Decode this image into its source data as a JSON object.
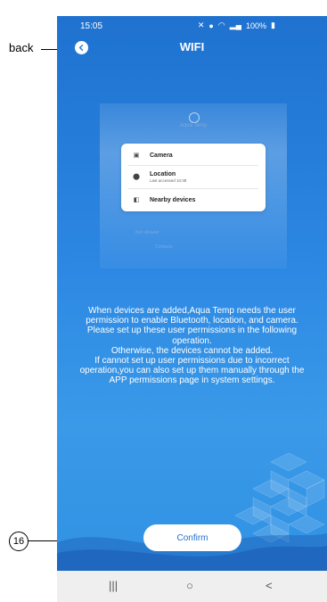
{
  "status_bar": {
    "time": "15:05",
    "battery": "100%"
  },
  "header": {
    "title": "WIFI"
  },
  "illustration": {
    "app_name": "Aqua Temp",
    "permissions": [
      {
        "label": "Camera",
        "sub": ""
      },
      {
        "label": "Location",
        "sub": "Last accessed 10:38"
      },
      {
        "label": "Nearby devices",
        "sub": ""
      }
    ],
    "not_allowed": "Not allowed",
    "faded_item": "Contacts"
  },
  "description": [
    "When devices are added,Aqua Temp needs the user permission to enable Bluetooth, location, and camera.",
    "Please set up these user permissions in the following operation.",
    "Otherwise, the devices cannot be added.",
    "If cannot set up user permissions due to incorrect operation,you can also set up them manually through the APP permissions page in system settings."
  ],
  "confirm_label": "Confirm",
  "annotations": {
    "back": "back",
    "number": "16"
  },
  "nav": {
    "recents": "|||",
    "home": "○",
    "back": "<"
  }
}
